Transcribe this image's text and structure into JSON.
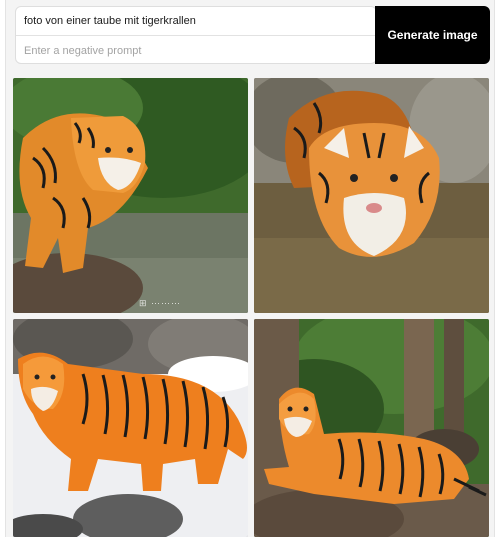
{
  "prompt": {
    "value": "foto von einer taube mit tigerkrallen",
    "negative_placeholder": "Enter a negative prompt"
  },
  "generate_button": {
    "label": "Generate image"
  },
  "colors": {
    "button_bg": "#000000",
    "button_text": "#ffffff",
    "panel_bg": "#f4f4f4"
  },
  "images": [
    {
      "subject": "tiger-walking-on-rock-by-water"
    },
    {
      "subject": "tiger-head-in-water"
    },
    {
      "subject": "tiger-walking-in-snow"
    },
    {
      "subject": "tiger-lying-on-rock-in-forest"
    }
  ]
}
